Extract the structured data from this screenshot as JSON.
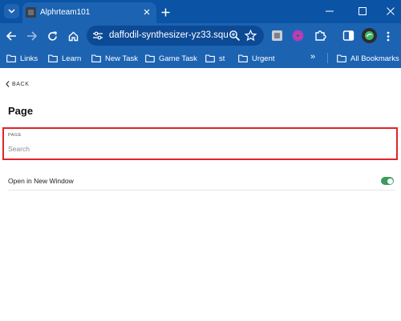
{
  "browser": {
    "tab_title": "Alphrteam101",
    "url": "daffodil-synthesizer-yz33.squ...",
    "bookmarks": [
      "Links",
      "Learn",
      "New Task",
      "Game Task",
      "st",
      "Urgent"
    ],
    "bookmarks_more": "»",
    "all_bookmarks": "All Bookmarks"
  },
  "page": {
    "back_label": "BACK",
    "title": "Page",
    "field_label": "PAGE",
    "field_placeholder": "Search",
    "field_value": "",
    "open_new_window_label": "Open in New Window",
    "open_new_window_on": true
  },
  "colors": {
    "tabbar": "#0b53a5",
    "toolbar": "#1c63b2",
    "highlight": "#e0242b",
    "toggle_on": "#3d9b5b"
  }
}
